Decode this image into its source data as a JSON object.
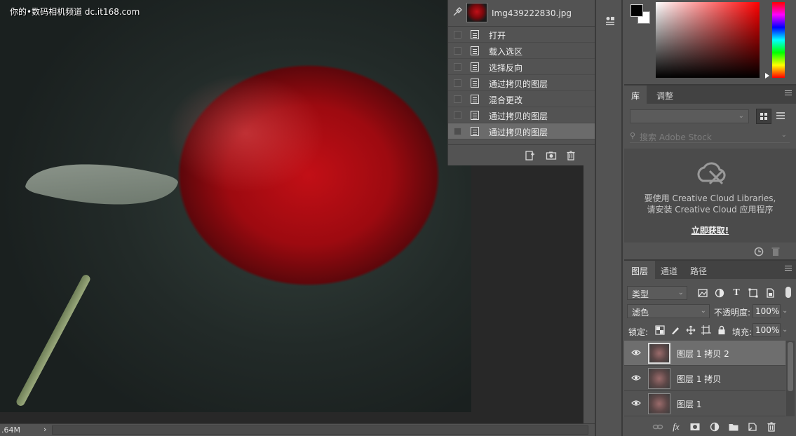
{
  "canvas": {
    "watermark": "你的•数码相机频道 dc.it168.com",
    "status_size": ".64M",
    "status_arrow": "›"
  },
  "history": {
    "snapshot_name": "Img439222830.jpg",
    "items": [
      {
        "label": "打开"
      },
      {
        "label": "载入选区"
      },
      {
        "label": "选择反向"
      },
      {
        "label": "通过拷贝的图层"
      },
      {
        "label": "混合更改"
      },
      {
        "label": "通过拷贝的图层"
      },
      {
        "label": "通过拷贝的图层"
      }
    ],
    "footer_icons": [
      "new-document-icon",
      "camera-icon",
      "trash-icon"
    ]
  },
  "color_panel": {
    "foreground": "#000000",
    "background": "#ffffff"
  },
  "library": {
    "tabs": [
      "库",
      "调整"
    ],
    "search_placeholder": "搜索 Adobe Stock",
    "message_line1": "要使用 Creative Cloud Libraries,",
    "message_line2": "请安装 Creative Cloud 应用程序",
    "get_link": "立即获取!"
  },
  "layers": {
    "tabs": [
      "图层",
      "通道",
      "路径"
    ],
    "filter_label": "类型",
    "blend_mode": "滤色",
    "opacity_label": "不透明度:",
    "opacity_value": "100%",
    "lock_label": "锁定:",
    "fill_label": "填充:",
    "fill_value": "100%",
    "rows": [
      {
        "name": "图层 1 拷贝 2"
      },
      {
        "name": "图层 1 拷贝"
      },
      {
        "name": "图层 1"
      }
    ],
    "icon_text_glyph": "T"
  }
}
